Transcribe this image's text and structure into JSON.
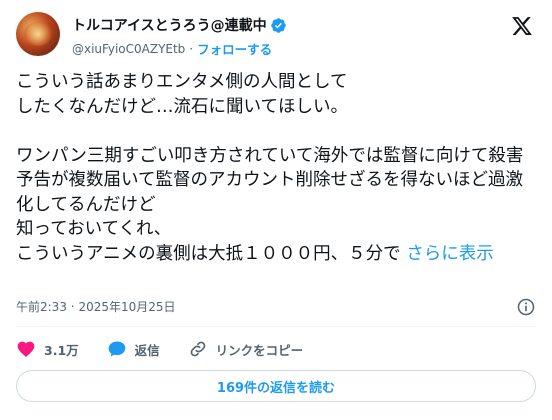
{
  "author": {
    "display_name": "トルコアイスとうろう@連載中",
    "handle": "@xiuFyioC0AZYEtb",
    "separator": "·",
    "follow_label": "フォローする"
  },
  "tweet": {
    "text": "こういう話あまりエンタメ側の人間として\nしたくなんだけど…流石に聞いてほしい。\n\nワンパン三期すごい叩き方されていて海外では監督に向けて殺害予告が複数届いて監督のアカウント削除せざるを得ないほど過激化してるんだけど\n知っておいてくれ、\nこういうアニメの裏側は大抵１０００円、５分で ",
    "more_label": "さらに表示"
  },
  "meta": {
    "time": "午前2:33",
    "separator": "·",
    "date": "2025年10月25日"
  },
  "actions": {
    "like_count": "3.1万",
    "reply_label": "返信",
    "copy_link_label": "リンクをコピー"
  },
  "read_replies_label": "169件の返信を読む",
  "colors": {
    "accent": "#1d9bf0",
    "like": "#f91880",
    "muted": "#536471",
    "text": "#0f1419"
  },
  "icons": {
    "verified": "verified-badge-icon",
    "x_logo": "x-logo-icon",
    "info": "info-icon",
    "like": "heart-icon",
    "reply": "speech-bubble-icon",
    "link": "link-icon"
  }
}
